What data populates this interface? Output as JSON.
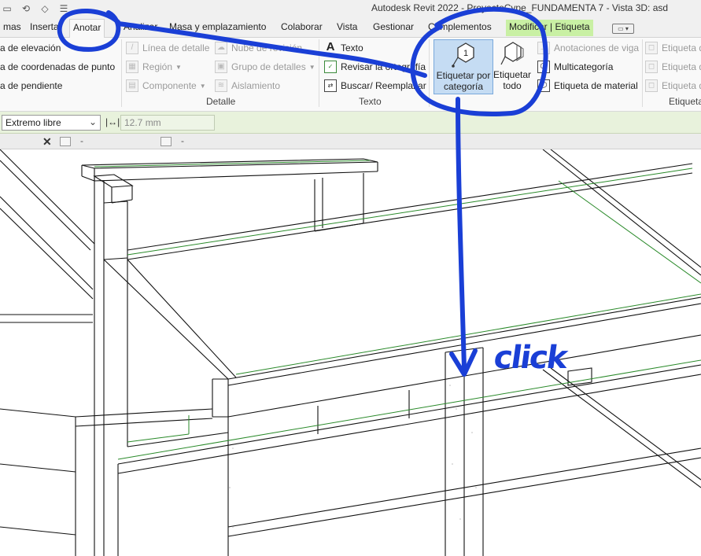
{
  "window": {
    "title": "Autodesk Revit 2022 - ProyectoCype_FUNDAMENTA 7 - Vista 3D: asd"
  },
  "tabs": [
    {
      "label": "mas"
    },
    {
      "label": "Insertar"
    },
    {
      "label": "Anotar"
    },
    {
      "label": "Analizar"
    },
    {
      "label": "Masa y emplazamiento"
    },
    {
      "label": "Colaborar"
    },
    {
      "label": "Vista"
    },
    {
      "label": "Gestionar"
    },
    {
      "label": "Complementos"
    },
    {
      "label": "Modificar | Etiqueta"
    }
  ],
  "ribbon": {
    "dimension_items": [
      {
        "label": "a de  elevación"
      },
      {
        "label": "a de  coordenadas de punto"
      },
      {
        "label": "a de  pendiente"
      }
    ],
    "detail_items": [
      {
        "label": "Línea de detalle"
      },
      {
        "label": "Región"
      },
      {
        "label": "Componente"
      },
      {
        "label": "Nube de revisión"
      },
      {
        "label": "Grupo de detalles"
      },
      {
        "label": "Aislamiento"
      }
    ],
    "detail_panel_label": "Detalle",
    "text_items": [
      {
        "label": "Texto"
      },
      {
        "label": "Revisar la  ortografía"
      },
      {
        "label": "Buscar/ Reemplazar"
      }
    ],
    "text_panel_label": "Texto",
    "tag_by_category": {
      "line1": "Etiquetar por",
      "line2": "categoría",
      "number": "1"
    },
    "tag_all": {
      "line1": "Etiquetar",
      "line2": "todo"
    },
    "tag_items": [
      {
        "label": "Anotaciones de viga"
      },
      {
        "label": "Multicategoría"
      },
      {
        "label": "Etiqueta de material"
      }
    ],
    "tag_panel_label": "Etiqueta",
    "right_items": [
      {
        "label": "Etiqueta d"
      },
      {
        "label": "Etiqueta d"
      },
      {
        "label": "Etiqueta d"
      }
    ]
  },
  "options_bar": {
    "leader_select": "Extremo libre",
    "length_value": "12.7 mm"
  },
  "view_tabs": [
    {
      "label": "-"
    },
    {
      "label": "-"
    }
  ],
  "annotation": {
    "note": "click",
    "color": "#1a3fd6"
  }
}
